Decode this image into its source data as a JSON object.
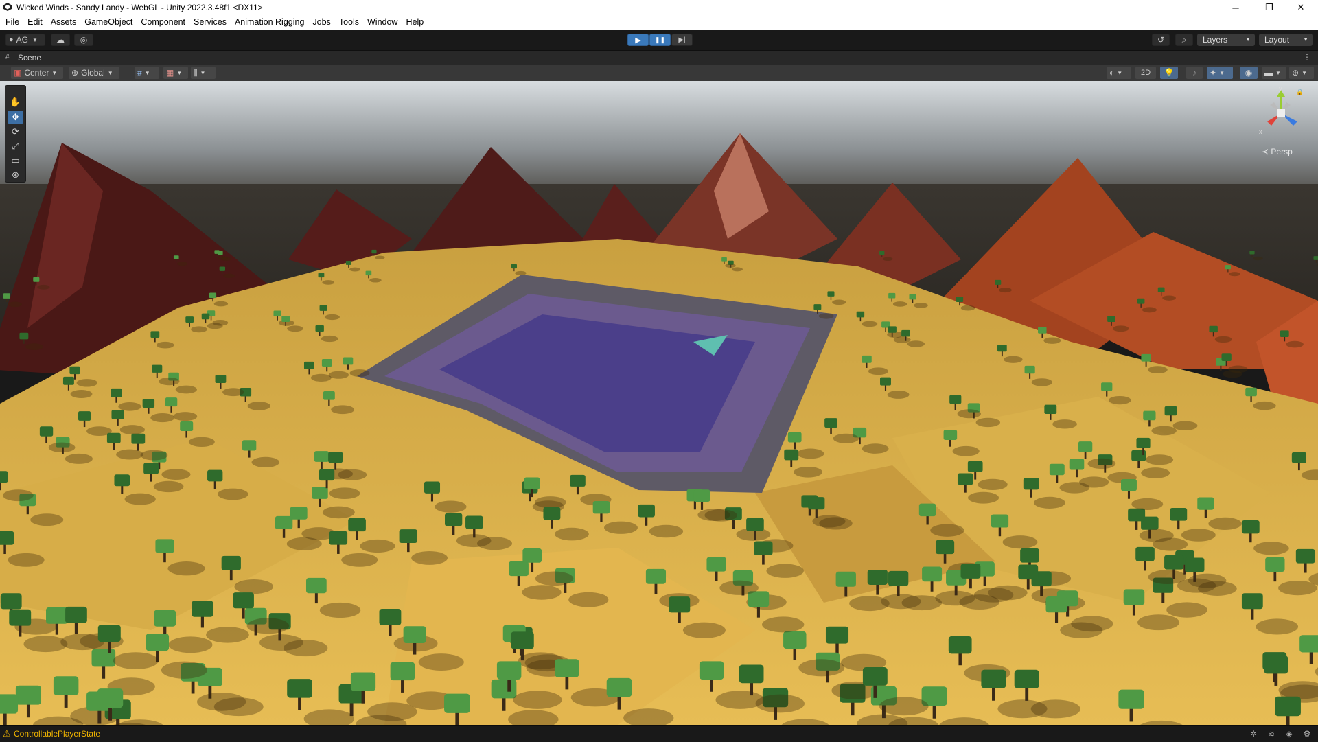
{
  "window": {
    "title": "Wicked Winds - Sandy Landy - WebGL - Unity 2022.3.48f1 <DX11>",
    "app_icon": "unity-logo-icon",
    "controls": {
      "minimize": "─",
      "maximize": "❐",
      "close": "✕"
    }
  },
  "menu": [
    "File",
    "Edit",
    "Assets",
    "GameObject",
    "Component",
    "Services",
    "Animation Rigging",
    "Jobs",
    "Tools",
    "Window",
    "Help"
  ],
  "toolbar": {
    "account_label": "AG",
    "account_icon": "account-icon",
    "cloud_icon": "cloud-icon",
    "collab_icon": "collab-icon",
    "play_icon": "▶",
    "pause_icon": "❚❚",
    "step_icon": "▶|",
    "history_icon": "history-icon",
    "search_icon": "search-icon",
    "layers_label": "Layers",
    "layout_label": "Layout"
  },
  "scene_tab": {
    "label": "Scene",
    "icon": "scene-hash-icon",
    "menu_icon": "⋮"
  },
  "scene_toolbar": {
    "pivot_label": "Center",
    "space_label": "Global",
    "mode_2d_label": "2D",
    "icons": [
      "grid-snap-icon",
      "grid-icon",
      "increment-snap-icon",
      "shading-mode-icon",
      "lighting-icon",
      "audio-icon",
      "effects-icon",
      "visibility-icon",
      "camera-icon",
      "gizmos-icon"
    ]
  },
  "tools": [
    "hand-tool-icon",
    "move-tool-icon",
    "rotate-tool-icon",
    "scale-tool-icon",
    "rect-tool-icon",
    "transform-tool-icon"
  ],
  "gizmo": {
    "x_label": "x",
    "y_label": "y",
    "projection_label": "≺ Persp",
    "lock_icon": "🔒"
  },
  "status": {
    "message": "ControllablePlayerState",
    "warning_icon": "⚠",
    "icons": [
      "bug-icon",
      "layers-status-icon",
      "network-icon",
      "settings-status-icon"
    ]
  },
  "colors": {
    "accent": "#3a79bb",
    "sand": "#e3b64f",
    "mountain": "#5a1f1c",
    "tree": "#3f8a3a",
    "warning": "#f0b400"
  }
}
